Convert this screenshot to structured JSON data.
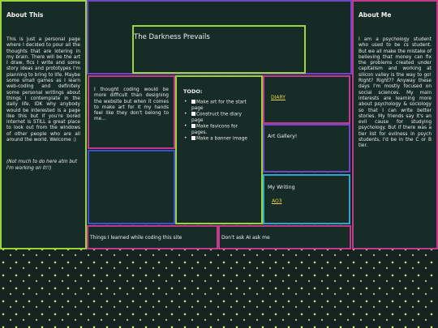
{
  "site_title": "The Darkness Prevails",
  "about_this": {
    "title": "About This",
    "body": "This is just a personal page where I decided to pour all the thoughts that are lotering in my brain. There will be the art I draw, fics I write and some story ideas and prototypes I'm planning to bring to life. Maybe some small games as I learn web-coding and definitely some personal writings about things I contemplate in the daily life. IDK why anybody would be interested is a page like this but if you're bored internet is STILL a great place to look out from the windows of other people who are all around the world. Welcome :)",
    "note": "(Not much to do here atm but I'm working on it!!)"
  },
  "about_me": {
    "title": "About Me",
    "body": "I am a psychology student who used to be cs student. But we all make the mistake of believing that money can fix the problems created under capitalism and working at silicon valley is the way to go! Right? Right?? Anyway these days I'm mostly focused on social sciences. My main interests are learning more about psychology & sociology so that I can write better stories. My friends say it's an evil cause for studying psychology. But if there was a tier list for evilness in psych students, I'd be in the C or B tier."
  },
  "thought": {
    "body": "I thought coding would be more difficult than designing the website but when it comes to make art for it my hands feel like they don't belong to me..."
  },
  "todo": {
    "title": "TODO:",
    "items": [
      "Make art for the start page",
      "Construct the diary page",
      "Make favicons for pages.",
      "Make a banner image"
    ]
  },
  "nav": {
    "diary": "DIARY",
    "art_gallery": "Art Gallery!",
    "my_writing": "My Writing",
    "ao3": "AO3"
  },
  "bottom": {
    "learned": "Things I learned while coding this site",
    "ask": "Don't ask AI ask me"
  },
  "colors": {
    "background": "#14231f",
    "panel": "#172c27",
    "border_blue": "#3a50d8",
    "border_lime": "#9ad43a",
    "border_pink": "#c23a8c",
    "link": "#e7d84a",
    "stars": "#e8e07a"
  }
}
